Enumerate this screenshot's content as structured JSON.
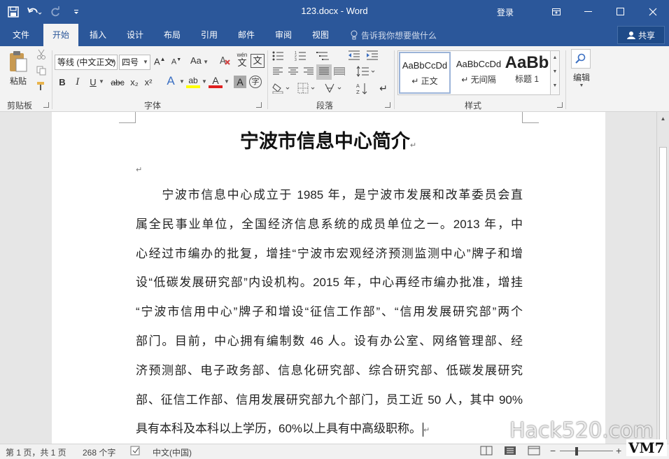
{
  "window": {
    "title": "123.docx  -  Word",
    "login": "登录"
  },
  "tabs": [
    {
      "label": "文件",
      "active": false
    },
    {
      "label": "开始",
      "active": true
    },
    {
      "label": "插入",
      "active": false
    },
    {
      "label": "设计",
      "active": false
    },
    {
      "label": "布局",
      "active": false
    },
    {
      "label": "引用",
      "active": false
    },
    {
      "label": "邮件",
      "active": false
    },
    {
      "label": "审阅",
      "active": false
    },
    {
      "label": "视图",
      "active": false
    }
  ],
  "tell_me": "告诉我你想要做什么",
  "share": "共享",
  "ribbon": {
    "clipboard": {
      "label": "剪贴板",
      "paste": "粘贴"
    },
    "font": {
      "label": "字体",
      "font_name": "等线 (中文正文)",
      "font_size": "四号",
      "aa": "Aa",
      "pinyin_top": "wén",
      "pinyin_char": "文",
      "bold": "B",
      "italic": "I",
      "underline": "U",
      "strike": "abc",
      "subscript": "x₂",
      "superscript": "x²",
      "highlight_char": "ab",
      "font_color_char": "A",
      "shade_char": "A",
      "circle_char": "字"
    },
    "paragraph": {
      "label": "段落"
    },
    "styles": {
      "label": "样式",
      "items": [
        {
          "preview": "AaBbCcDd",
          "name": "↵ 正文"
        },
        {
          "preview": "AaBbCcDd",
          "name": "↵ 无间隔"
        },
        {
          "preview": "AaBb",
          "name": "标题 1"
        }
      ]
    },
    "editing": {
      "label": "编辑"
    }
  },
  "document": {
    "title": "宁波市信息中心简介",
    "lines": [
      "　　宁波市信息中心成立于 1985 年，是宁波市发展和改革委员会直",
      "属全民事业单位，全国经济信息系统的成员单位之一。2013  年，中",
      "心经过市编办的批复，增挂“宁波市宏观经济预测监测中心”牌子和增",
      "设“低碳发展研究部”内设机构。2015 年，中心再经市编办批准，增挂",
      "“宁波市信用中心”牌子和增设“征信工作部”、“信用发展研究部”两个",
      "部门。目前，中心拥有编制数 46 人。设有办公室、网络管理部、经",
      "济预测部、电子政务部、信息化研究部、综合研究部、低碳发展研究",
      "部、征信工作部、信用发展研究部九个部门，员工近 50 人，其中 90%",
      "具有本科及本科以上学历，60%以上具有中高级职称。"
    ]
  },
  "status": {
    "page": "第 1 页，共 1 页",
    "words": "268 个字",
    "language": "中文(中国)"
  },
  "watermark": "Hack520.com",
  "badge": "VM7"
}
